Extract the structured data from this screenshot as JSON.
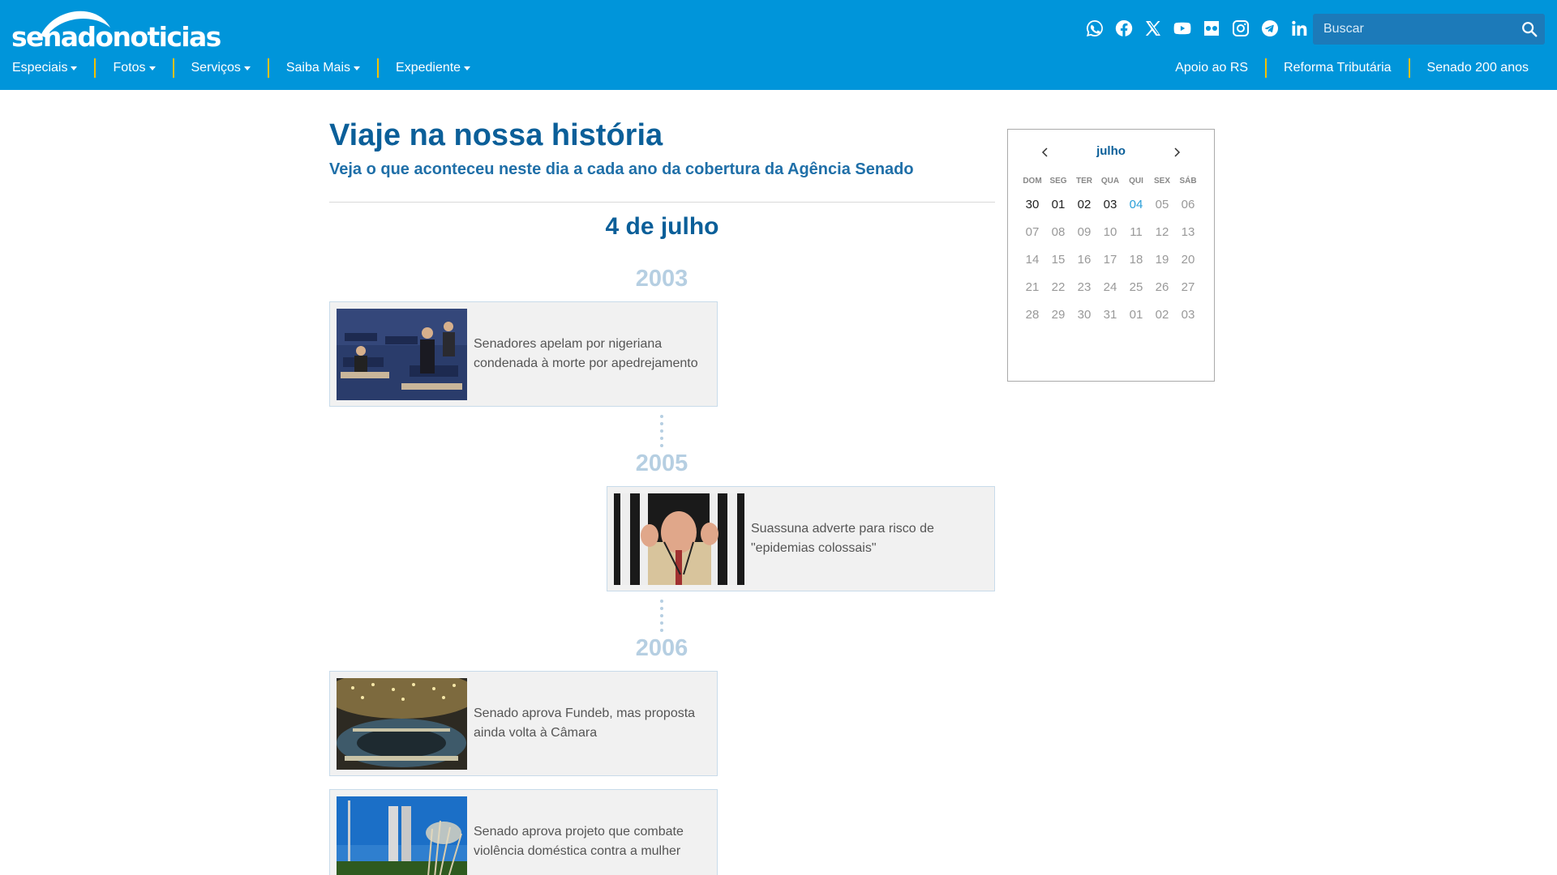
{
  "header": {
    "logo_text": "senadonoticias",
    "search_placeholder": "Buscar",
    "social": [
      "whatsapp-icon",
      "facebook-icon",
      "x-icon",
      "youtube-icon",
      "flickr-icon",
      "instagram-icon",
      "telegram-icon",
      "linkedin-icon"
    ],
    "nav": [
      {
        "label": "Especiais"
      },
      {
        "label": "Fotos"
      },
      {
        "label": "Serviços"
      },
      {
        "label": "Saiba Mais"
      },
      {
        "label": "Expediente"
      }
    ],
    "nav_right": [
      {
        "label": "Apoio ao RS"
      },
      {
        "label": "Reforma Tributária"
      },
      {
        "label": "Senado 200 anos"
      }
    ],
    "colors": {
      "bar": "#0095da",
      "separator": "#f2c200"
    }
  },
  "main": {
    "title": "Viaje na nossa história",
    "subtitle": "Veja o que aconteceu neste dia a cada ano da cobertura da Agência Senado",
    "date_heading": "4 de julho",
    "timeline": [
      {
        "year": "2003",
        "items": [
          {
            "text": "Senadores apelam por nigeriana condenada à morte por apedrejamento"
          }
        ]
      },
      {
        "year": "2005",
        "items": [
          {
            "text": "Suassuna adverte para risco de \"epidemias colossais\""
          }
        ]
      },
      {
        "year": "2006",
        "items": [
          {
            "text": "Senado aprova Fundeb, mas proposta ainda volta à Câmara"
          },
          {
            "text": "Senado aprova projeto que combate violência doméstica contra a mulher"
          }
        ]
      }
    ]
  },
  "calendar": {
    "month": "julho",
    "weekdays": [
      "DOM",
      "SEG",
      "TER",
      "QUA",
      "QUI",
      "SEX",
      "SÁB"
    ],
    "weeks": [
      [
        "30",
        "01",
        "02",
        "03",
        "04",
        "05",
        "06"
      ],
      [
        "07",
        "08",
        "09",
        "10",
        "11",
        "12",
        "13"
      ],
      [
        "14",
        "15",
        "16",
        "17",
        "18",
        "19",
        "20"
      ],
      [
        "21",
        "22",
        "23",
        "24",
        "25",
        "26",
        "27"
      ],
      [
        "28",
        "29",
        "30",
        "31",
        "01",
        "02",
        "03"
      ]
    ],
    "selected": "04",
    "colors": {
      "selected": "#2a9fd8",
      "title": "#0b5f99"
    }
  }
}
